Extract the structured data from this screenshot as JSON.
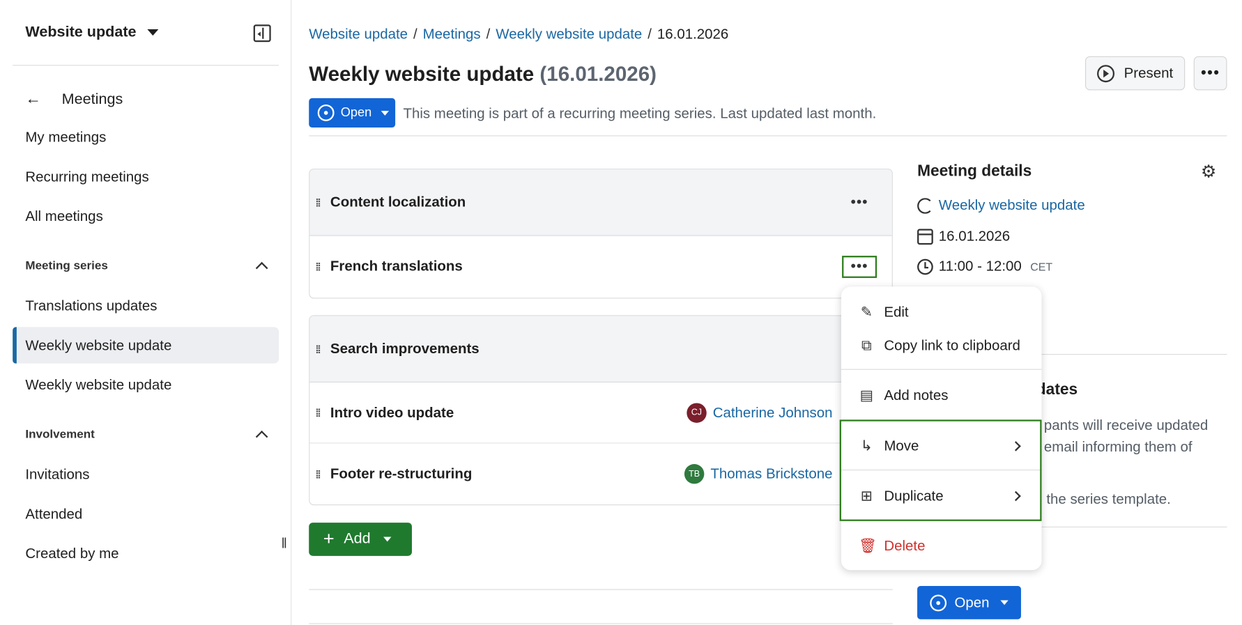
{
  "sidebar": {
    "project": "Website update",
    "back_label": "Meetings",
    "items_top": [
      "My meetings",
      "Recurring meetings",
      "All meetings"
    ],
    "section_series": "Meeting series",
    "series_items": [
      "Translations updates",
      "Weekly website update",
      "Weekly website update"
    ],
    "section_involvement": "Involvement",
    "involvement_items": [
      "Invitations",
      "Attended",
      "Created by me"
    ]
  },
  "breadcrumb": {
    "b1": "Website update",
    "b2": "Meetings",
    "b3": "Weekly website update",
    "current": "16.01.2026",
    "sep": "/"
  },
  "header": {
    "title": "Weekly website update",
    "date": "(16.01.2026)",
    "present_label": "Present",
    "status_label": "Open",
    "status_text": "This meeting is part of a recurring meeting series. Last updated last month."
  },
  "agenda": {
    "sec1": "Content localization",
    "sec1_items": [
      "French translations"
    ],
    "sec2": "Search improvements",
    "sec2_items": [
      {
        "title": "Intro video update",
        "owner": "Catherine Johnson",
        "initials": "CJ",
        "color": "#7a1f2b"
      },
      {
        "title": "Footer re-structuring",
        "owner": "Thomas Brickstone",
        "initials": "TB",
        "color": "#2f7a3e"
      }
    ],
    "add_label": "Add"
  },
  "details": {
    "title": "Meeting details",
    "series_link": "Weekly website update",
    "date": "16.01.2026",
    "time": "11:00 - 12:00",
    "tz": "CET",
    "updates_heading_partial": "pdates",
    "updates_text1": "pants will receive updated",
    "updates_text2": "email informing them of",
    "updates_text3": "the series template.",
    "open_label": "Open"
  },
  "menu": {
    "edit": "Edit",
    "copy": "Copy link to clipboard",
    "notes": "Add notes",
    "move": "Move",
    "duplicate": "Duplicate",
    "delete": "Delete"
  },
  "colors": {
    "link": "#1a67a3",
    "primary": "#1265d6",
    "success": "#1f7a2e",
    "danger": "#d0312d",
    "highlight": "#2e7d1e"
  }
}
